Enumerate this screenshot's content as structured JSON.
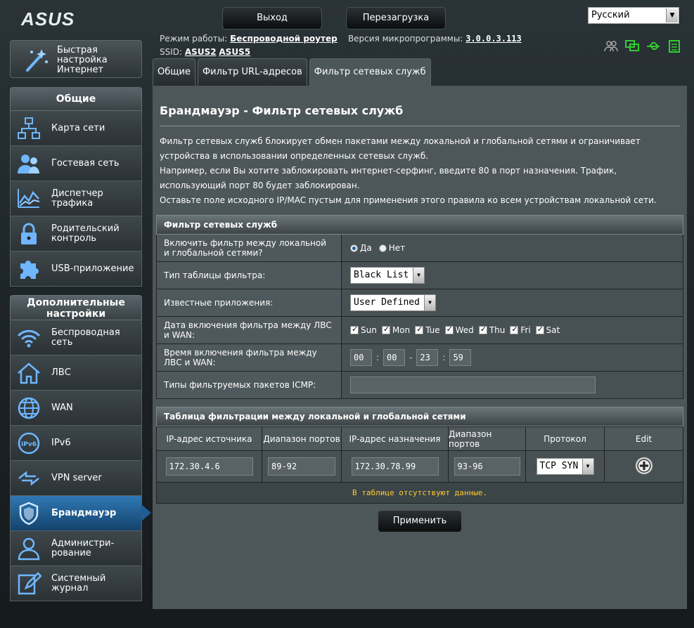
{
  "brand": "ASUS",
  "header": {
    "logout_label": "Выход",
    "reboot_label": "Перезагрузка",
    "language": "Русский",
    "mode_label": "Режим работы:",
    "mode_value": "Беспроводной роутер",
    "fw_label": "Версия микропрограммы:",
    "fw_value": "3.0.0.3.113",
    "ssid_label": "SSID:",
    "ssid1": "ASUS2",
    "ssid2": "ASUS5"
  },
  "sidebar": {
    "quick_setup": "Быстрая настройка Интернет",
    "general_title": "Общие",
    "general_items": [
      {
        "label": "Карта сети",
        "icon": "network-map-icon"
      },
      {
        "label": "Гостевая сеть",
        "icon": "guest-network-icon"
      },
      {
        "label": "Диспетчер трафика",
        "icon": "traffic-manager-icon"
      },
      {
        "label": "Родительский контроль",
        "icon": "parental-control-icon"
      },
      {
        "label": "USB-приложение",
        "icon": "usb-app-icon"
      }
    ],
    "advanced_title": "Дополнительные настройки",
    "advanced_items": [
      {
        "label": "Беспроводная сеть",
        "icon": "wireless-icon"
      },
      {
        "label": "ЛВС",
        "icon": "lan-icon"
      },
      {
        "label": "WAN",
        "icon": "wan-icon"
      },
      {
        "label": "IPv6",
        "icon": "ipv6-icon"
      },
      {
        "label": "VPN server",
        "icon": "vpn-icon"
      },
      {
        "label": "Брандмауэр",
        "icon": "firewall-icon"
      },
      {
        "label": "Администри-рование",
        "icon": "admin-icon"
      },
      {
        "label": "Системный журнал",
        "icon": "system-log-icon"
      }
    ]
  },
  "tabs": [
    "Общие",
    "Фильтр URL-адресов",
    "Фильтр сетевых служб"
  ],
  "page": {
    "title": "Брандмауэр - Фильтр сетевых служб",
    "desc1": "Фильтр сетевых служб блокирует обмен пакетами между локальной и глобальной сетями и ограничивает устройства в использовании определенных сетевых служб.",
    "desc2": "Например, если Вы хотите заблокировать интернет-серфинг, введите 80 в порт назначения. Трафик, использующий порт 80 будет заблокирован.",
    "desc3": "Оставьте поле исходного IP/MAC пустым для применения этого правила ко всем устройствам локальной сети."
  },
  "filter": {
    "section_title": "Фильтр сетевых служб",
    "enable_label": "Включить фильтр между локальной и глобальной сетями?",
    "yes": "Да",
    "no": "Нет",
    "table_type_label": "Тип таблицы фильтра:",
    "table_type": "Black List",
    "known_apps_label": "Известные приложения:",
    "known_apps": "User Defined",
    "days_label": "Дата включения фильтра между ЛВС и WAN:",
    "days": [
      "Sun",
      "Mon",
      "Tue",
      "Wed",
      "Thu",
      "Fri",
      "Sat"
    ],
    "time_label": "Время включения фильтра между ЛВС и WAN:",
    "time": [
      "00",
      "00",
      "23",
      "59"
    ],
    "icmp_label": "Типы фильтруемых пакетов ICMP:",
    "icmp_value": ""
  },
  "rules": {
    "title": "Таблица фильтрации между локальной и глобальной сетями",
    "headers": [
      "IP-адрес источника",
      "Диапазон портов",
      "IP-адрес назначения",
      "Диапазон портов",
      "Протокол",
      "Edit"
    ],
    "input": [
      "172.30.4.6",
      "89-92",
      "172.30.78.99",
      "93-96",
      "TCP SYN"
    ],
    "empty": "В таблице отсутствуют данные."
  },
  "apply_label": "Применить"
}
